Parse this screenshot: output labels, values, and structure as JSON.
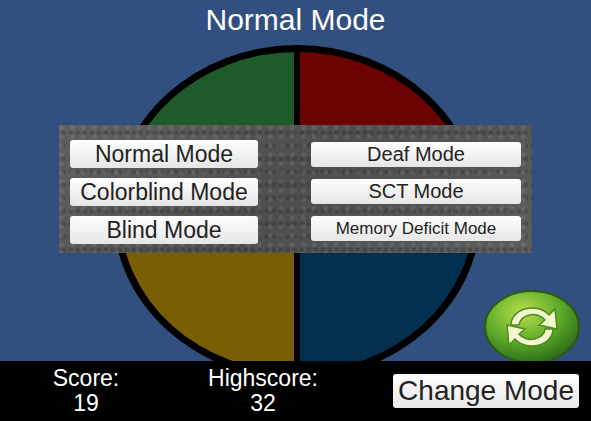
{
  "title": "Normal Mode",
  "board": {
    "quadrants": [
      {
        "color": "#1d5b2b"
      },
      {
        "color": "#6c0202"
      },
      {
        "color": "#7a5e03"
      },
      {
        "color": "#03304f"
      }
    ]
  },
  "modes": {
    "left": [
      {
        "label": "Normal Mode"
      },
      {
        "label": "Colorblind Mode"
      },
      {
        "label": "Blind Mode"
      }
    ],
    "right": [
      {
        "label": "Deaf Mode"
      },
      {
        "label": "SCT Mode"
      },
      {
        "label": "Memory Deficit Mode"
      }
    ]
  },
  "footer": {
    "score_label": "Score:",
    "score": "19",
    "highscore_label": "Highscore:",
    "highscore": "32",
    "button": "Change Mode"
  }
}
